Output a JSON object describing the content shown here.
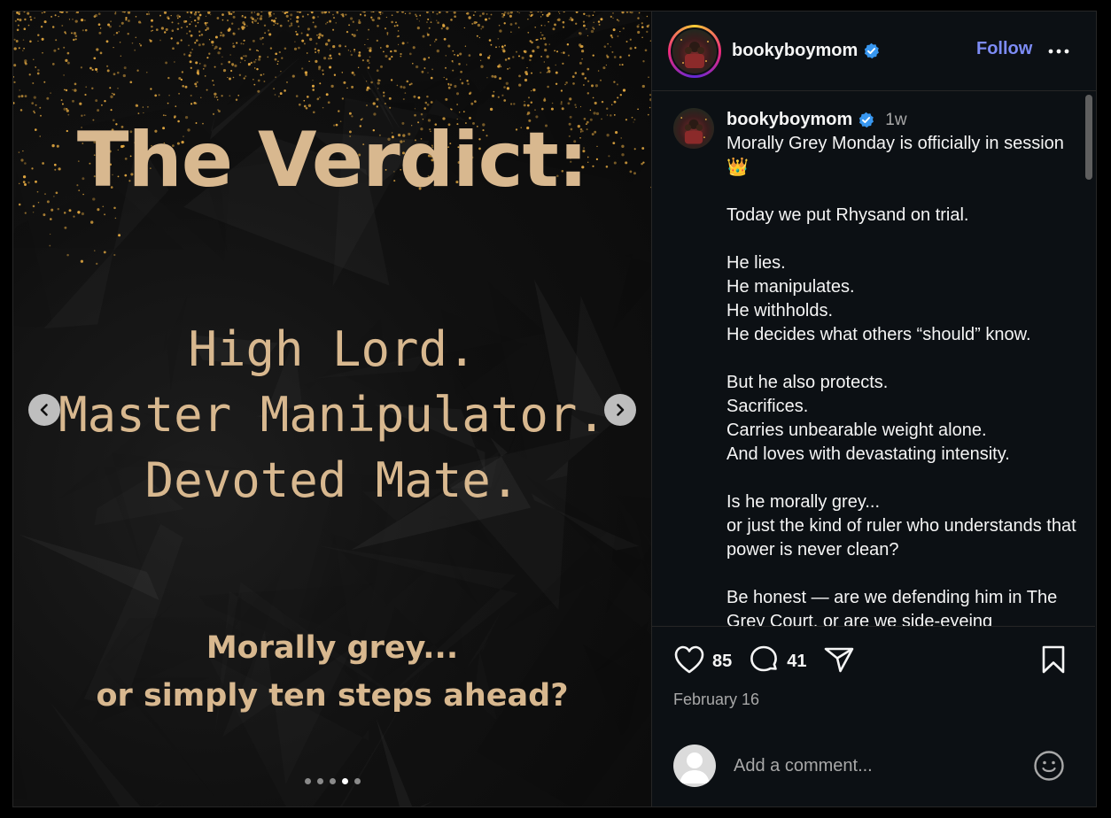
{
  "slide": {
    "title": "The Verdict:",
    "lines": [
      "High Lord.",
      "Master Manipulator.",
      "Devoted Mate."
    ],
    "question_line1": "Morally grey...",
    "question_line2": "or simply ten steps ahead?",
    "dots_total": 5,
    "active_dot": 4
  },
  "header": {
    "username": "bookyboymom",
    "follow_label": "Follow"
  },
  "caption": {
    "username": "bookyboymom",
    "time": "1w",
    "text": "Morally Grey Monday is officially in session 👑\n\nToday we put Rhysand on trial.\n\nHe lies.\nHe manipulates.\nHe withholds.\nHe decides what others “should” know.\n\nBut he also protects.\nSacrifices.\nCarries unbearable weight alone.\nAnd loves with devastating intensity.\n\nIs he morally grey...\nor just the kind of ruler who understands that power is never clean?\n\nBe honest — are we defending him in The Grey Court, or are we side-eyeing"
  },
  "actions": {
    "likes": "85",
    "comments": "41",
    "date": "February 16"
  },
  "comment_box": {
    "placeholder": "Add a comment..."
  },
  "colors": {
    "accent_follow": "#7d8cf5",
    "slide_text": "#d8b88f",
    "verified": "#3897f0",
    "glitter": "#e0a640"
  },
  "icons": [
    "chevron-left-icon",
    "chevron-right-icon",
    "verified-icon",
    "more-icon",
    "heart-icon",
    "comment-icon",
    "share-icon",
    "bookmark-icon",
    "emoji-icon",
    "user-icon"
  ]
}
